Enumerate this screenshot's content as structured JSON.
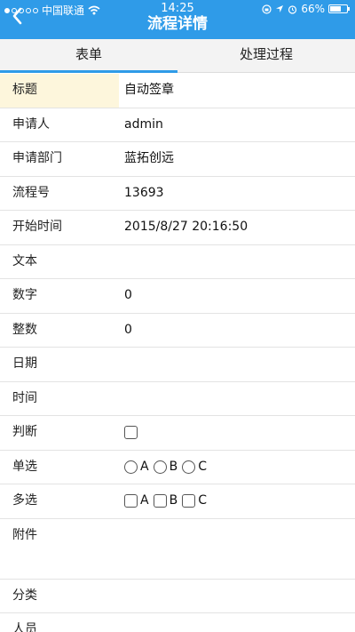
{
  "status": {
    "carrier": "中国联通",
    "time": "14:25",
    "battery": "66%",
    "battery_level": 0.66
  },
  "nav": {
    "title": "流程详情"
  },
  "tabs": [
    {
      "label": "表单",
      "active": true
    },
    {
      "label": "处理过程",
      "active": false
    }
  ],
  "form": {
    "title": {
      "label": "标题",
      "value": "自动签章"
    },
    "applicant": {
      "label": "申请人",
      "value": "admin"
    },
    "department": {
      "label": "申请部门",
      "value": "蓝拓创远"
    },
    "process_no": {
      "label": "流程号",
      "value": "13693"
    },
    "start_time": {
      "label": "开始时间",
      "value": "2015/8/27 20:16:50"
    },
    "text": {
      "label": "文本",
      "value": ""
    },
    "number": {
      "label": "数字",
      "value": "0"
    },
    "integer": {
      "label": "整数",
      "value": "0"
    },
    "date": {
      "label": "日期",
      "value": ""
    },
    "time": {
      "label": "时间",
      "value": ""
    },
    "judge": {
      "label": "判断",
      "checked": false
    },
    "single_choice": {
      "label": "单选",
      "options": [
        "A",
        "B",
        "C"
      ]
    },
    "multi_choice": {
      "label": "多选",
      "options": [
        "A",
        "B",
        "C"
      ]
    },
    "attachment": {
      "label": "附件"
    },
    "category": {
      "label": "分类"
    },
    "people": {
      "label": "人员"
    }
  }
}
